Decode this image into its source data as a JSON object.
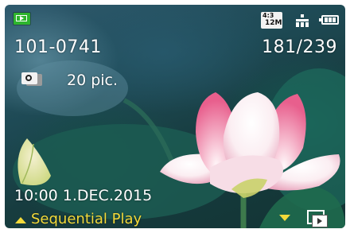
{
  "mode": {
    "icon": "playback-mode-icon",
    "color": "#2eb52e"
  },
  "status": {
    "aspect_ratio": "4:3",
    "resolution": "12M",
    "quality_icon": "quality-stacked-icon",
    "battery_icon": "battery-icon",
    "battery_level": 0.75
  },
  "file": {
    "number": "101-0741",
    "counter": "181/239"
  },
  "burst": {
    "icon": "burst-group-icon",
    "count_label": "20 pic."
  },
  "datetime": "10:00  1.DEC.2015",
  "footer": {
    "up_arrow_icon": "up-arrow-icon",
    "action_label": "Sequential Play",
    "down_arrow_icon": "down-arrow-icon",
    "mode_icon": "group-playback-icon",
    "accent_color": "#f3da3a"
  }
}
